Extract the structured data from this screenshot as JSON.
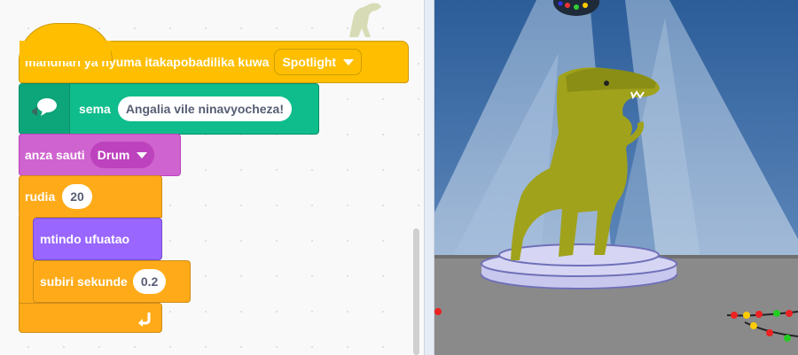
{
  "blocks": {
    "backdrop": {
      "label": "mandhari ya nyuma itakapobadilika kuwa",
      "value": "Spotlight"
    },
    "say": {
      "label": "sema",
      "value": "Angalia vile ninavyocheza!"
    },
    "sound": {
      "label": "anza sauti",
      "value": "Drum"
    },
    "repeat": {
      "label": "rudia",
      "value": "20"
    },
    "costume": {
      "label": "mtindo ufuatao"
    },
    "wait": {
      "label": "subiri sekunde",
      "value": "0.2"
    }
  },
  "colors": {
    "events": "#ffbf00",
    "events_border": "#cc9900",
    "extension": "#0fbd8c",
    "extension_border": "#0b8e69",
    "sound": "#cf63cf",
    "sound_border": "#bd42bd",
    "control": "#ffab19",
    "control_border": "#cf8b17",
    "looks": "#9966ff",
    "looks_border": "#774dcb",
    "dinosaur": "#a0a21b"
  },
  "icons": [
    "speech-bubble-icon",
    "dropdown-caret-icon",
    "loop-arrow-icon",
    "sprite-thumbnail-icon",
    "disco-ball-icon"
  ]
}
